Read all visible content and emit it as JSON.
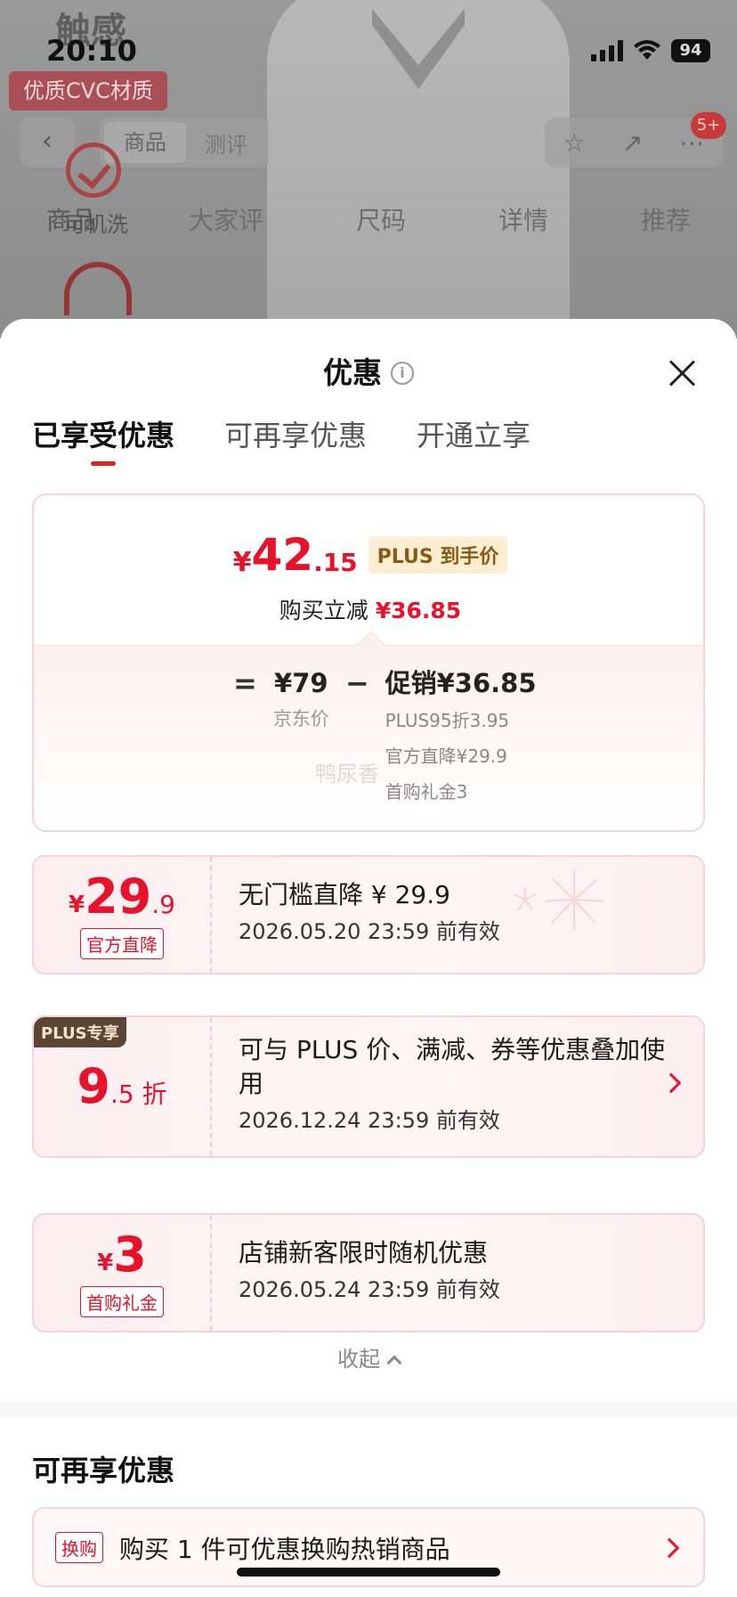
{
  "status_bar": {
    "time": "20:10",
    "battery": "94"
  },
  "background_page": {
    "top_word": "触感",
    "material_tag": "优质CVC材质",
    "segment_tabs": [
      "商品",
      "测评"
    ],
    "badge": "5+",
    "nav_tabs": [
      "商品",
      "大家评",
      "尺码",
      "详情",
      "推荐"
    ],
    "wash_label": "可机洗"
  },
  "sheet": {
    "title": "优惠",
    "tabs": [
      "已享受优惠",
      "可再享优惠",
      "开通立享"
    ],
    "summary": {
      "currency": "¥",
      "price_int": "42",
      "price_dec": ".15",
      "plus_label": "PLUS 到手价",
      "reduce_label": "购买立减",
      "reduce_value": "¥36.85",
      "equals": "=",
      "minus": "−",
      "jd_price": "¥79",
      "jd_price_label": "京东价",
      "promo_total": "促销¥36.85",
      "promo_items": [
        "PLUS95折3.95",
        "官方直降¥29.9",
        "首购礼金3"
      ],
      "watermark": "鸭尿香"
    },
    "coupons": [
      {
        "currency": "¥",
        "big": "29",
        "small": ".9",
        "tag": "官方直降",
        "title": "无门槛直降 ¥ 29.9",
        "date": "2026.05.20 23:59 前有效"
      },
      {
        "corner": "PLUS专享",
        "big": "9",
        "small": ".5 折",
        "title": "可与 PLUS 价、满减、券等优惠叠加使用",
        "date": "2026.12.24 23:59 前有效"
      },
      {
        "currency": "¥",
        "big": "3",
        "tag": "首购礼金",
        "title": "店铺新客限时随机优惠",
        "date": "2026.05.24 23:59 前有效"
      }
    ],
    "collapse_label": "收起",
    "more_section_title": "可再享优惠",
    "exchange": {
      "tag": "换购",
      "text": "购买 1 件可优惠换购热销商品"
    }
  },
  "colors": {
    "accent_red": "#e8122a",
    "plus_gold_bg": "#fbeed3",
    "card_border": "#f8d3d6"
  }
}
